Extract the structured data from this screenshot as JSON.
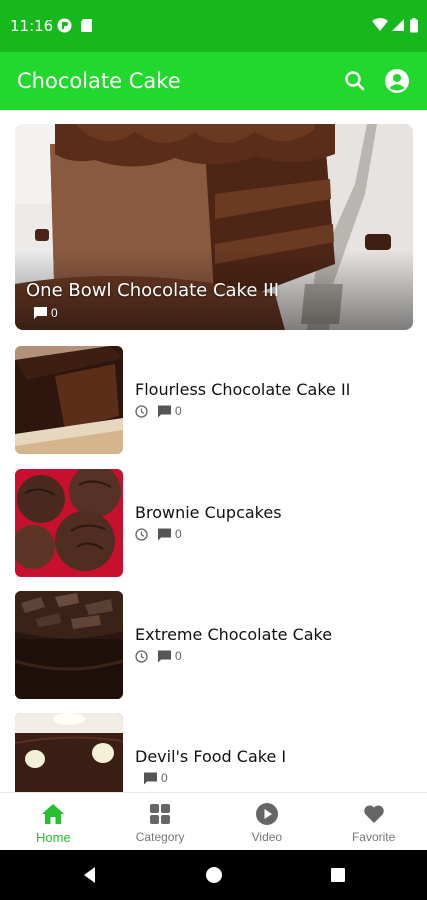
{
  "status_bar": {
    "time": "11:16",
    "left_icons": [
      "app-status-icon",
      "sd-card-icon"
    ],
    "right_icons": [
      "wifi-icon",
      "signal-icon",
      "battery-icon"
    ]
  },
  "app_bar": {
    "title": "Chocolate Cake",
    "actions": [
      "search-icon",
      "account-icon"
    ]
  },
  "featured": {
    "title": "One Bowl Chocolate Cake III",
    "comments": "0",
    "image": "chocolate-cake-slice-with-fork"
  },
  "recipes": [
    {
      "title": "Flourless Chocolate Cake II",
      "comments": "0",
      "show_time": true,
      "image": "flourless-cake-slice"
    },
    {
      "title": "Brownie Cupcakes",
      "comments": "0",
      "show_time": true,
      "image": "brownie-cupcakes"
    },
    {
      "title": "Extreme Chocolate Cake",
      "comments": "0",
      "show_time": true,
      "image": "shaved-chocolate-cake"
    },
    {
      "title": "Devil's Food Cake I",
      "comments": "0",
      "show_time": false,
      "image": "devils-food-cake"
    }
  ],
  "bottom_nav": [
    {
      "label": "Home",
      "icon": "home-icon",
      "active": true
    },
    {
      "label": "Category",
      "icon": "category-icon",
      "active": false
    },
    {
      "label": "Video",
      "icon": "video-icon",
      "active": false
    },
    {
      "label": "Favorite",
      "icon": "heart-icon",
      "active": false
    }
  ],
  "system_nav": [
    "back-button",
    "home-button",
    "recents-button"
  ],
  "colors": {
    "status_bar": "#16b81e",
    "app_bar": "#22d82c",
    "nav_active": "#22c22c",
    "nav_inactive": "#777777"
  }
}
